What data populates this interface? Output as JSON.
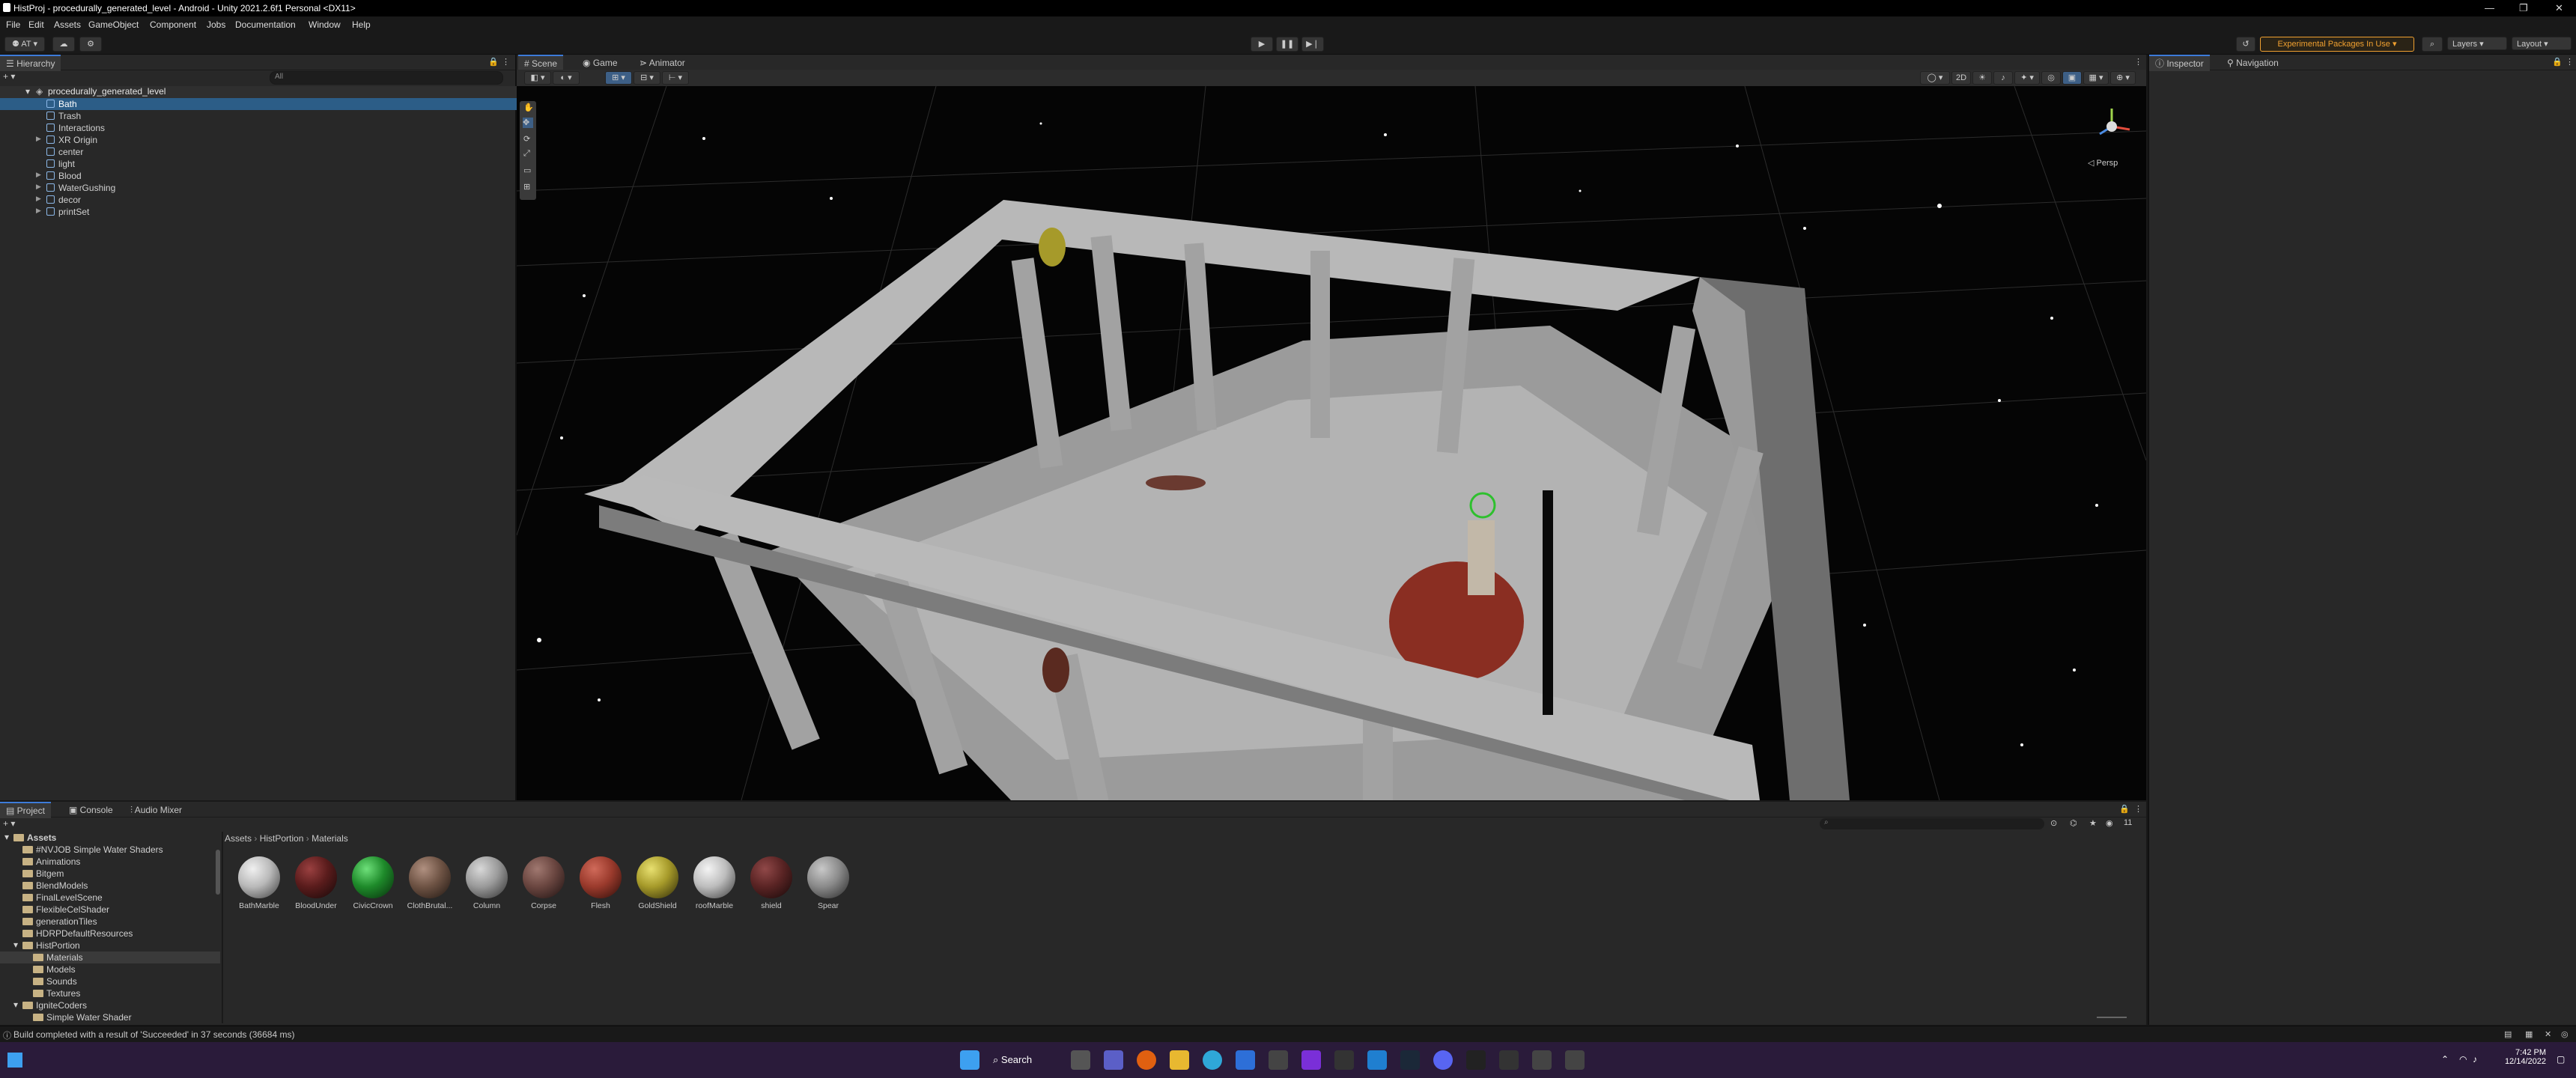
{
  "window": {
    "title": "HistProj - procedurally_generated_level - Android - Unity 2021.2.6f1 Personal <DX11>"
  },
  "menu": [
    "File",
    "Edit",
    "Assets",
    "GameObject",
    "Component",
    "Jobs",
    "Documentation",
    "Window",
    "Help"
  ],
  "toolbar": {
    "account": "AT",
    "experimental": "Experimental Packages In Use ▾",
    "layers": "Layers",
    "layout": "Layout"
  },
  "hierarchy": {
    "tab": "Hierarchy",
    "search_placeholder": "All",
    "scene": "procedurally_generated_level",
    "items": [
      "Bath",
      "Trash",
      "Interactions",
      "XR Origin",
      "center",
      "light",
      "Blood",
      "WaterGushing",
      "decor",
      "printSet"
    ]
  },
  "scene_tabs": {
    "scene": "Scene",
    "game": "Game",
    "animator": "Animator"
  },
  "scene_view": {
    "gizmo_label": "Persp",
    "colors": {
      "sky": "#050505",
      "marble": "#a6a6a6",
      "carpet": "#8a2e22"
    }
  },
  "inspector": {
    "inspector_tab": "Inspector",
    "navigation_tab": "Navigation"
  },
  "project": {
    "tabs": [
      "Project",
      "Console",
      "Audio Mixer"
    ],
    "breadcrumb": [
      "Assets",
      "HistPortion",
      "Materials"
    ],
    "tree_root": "Assets",
    "tree": [
      "#NVJOB Simple Water Shaders",
      "Animations",
      "Bitgem",
      "BlendModels",
      "FinalLevelScene",
      "FlexibleCelShader",
      "generationTiles",
      "HDRPDefaultResources",
      "HistPortion",
      "Materials",
      "Models",
      "Sounds",
      "Textures",
      "IgniteCoders",
      "Simple Water Shader"
    ],
    "assets": [
      {
        "name": "BathMarble",
        "color": "#b9b9b9"
      },
      {
        "name": "BloodUnder",
        "color": "#5a1c1c"
      },
      {
        "name": "CivicCrown",
        "color": "#1e8a2a"
      },
      {
        "name": "ClothBrutal...",
        "color": "#6e5344"
      },
      {
        "name": "Column",
        "color": "#9a9a9a"
      },
      {
        "name": "Corpse",
        "color": "#6a4640"
      },
      {
        "name": "Flesh",
        "color": "#9a3a2c"
      },
      {
        "name": "GoldShield",
        "color": "#a69a2a"
      },
      {
        "name": "roofMarble",
        "color": "#bdbdbd"
      },
      {
        "name": "shield",
        "color": "#5a2424"
      },
      {
        "name": "Spear",
        "color": "#8a8a8a"
      }
    ],
    "search_count": "11"
  },
  "status": {
    "message": "Build completed with a result of 'Succeeded' in 37 seconds (36684 ms)"
  },
  "taskbar": {
    "search": "Search",
    "time": "7:42 PM",
    "date": "12/14/2022"
  }
}
